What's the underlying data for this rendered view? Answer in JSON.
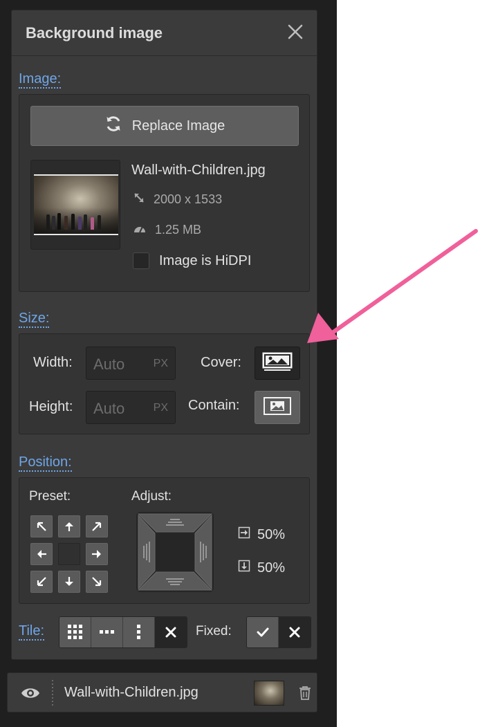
{
  "panel": {
    "title": "Background image",
    "close_icon": "close-icon"
  },
  "image_section": {
    "label": "Image:",
    "replace_label": "Replace Image",
    "replace_icon": "refresh-icon",
    "filename": "Wall-with-Children.jpg",
    "dimensions": "2000 x 1533",
    "filesize": "1.25 MB",
    "hidpi_label": "Image is HiDPI",
    "hidpi_checked": false
  },
  "size_section": {
    "label": "Size:",
    "width_label": "Width:",
    "width_placeholder": "Auto",
    "height_label": "Height:",
    "height_placeholder": "Auto",
    "unit": "PX",
    "cover_label": "Cover:",
    "contain_label": "Contain:",
    "selected_fit": "cover"
  },
  "position_section": {
    "label": "Position:",
    "preset_label": "Preset:",
    "adjust_label": "Adjust:",
    "x_percent": "50%",
    "y_percent": "50%"
  },
  "tile_section": {
    "label": "Tile:",
    "fixed_label": "Fixed:",
    "selected_tile": "none",
    "fixed": false
  },
  "layer": {
    "name": "Wall-with-Children.jpg",
    "visible_icon": "eye-icon",
    "delete_icon": "trash-icon"
  },
  "colors": {
    "accent": "#6fa6e8",
    "panel_bg": "#3b3b3b",
    "annotation_arrow": "#f0609a"
  }
}
